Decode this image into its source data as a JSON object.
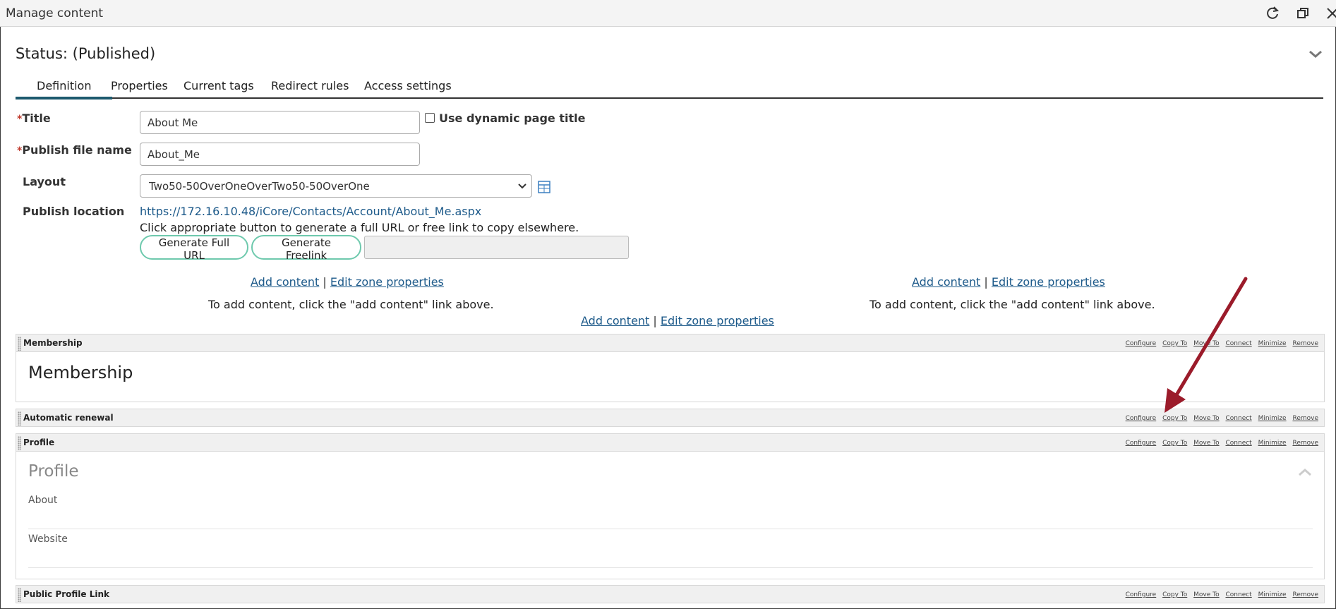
{
  "window": {
    "title": "Manage content",
    "icons": [
      "refresh-icon",
      "restore-icon",
      "close-icon"
    ]
  },
  "status": {
    "text": "Status: (Published)"
  },
  "tabs": [
    {
      "label": "Definition",
      "active": true
    },
    {
      "label": "Properties",
      "active": false
    },
    {
      "label": "Current tags",
      "active": false
    },
    {
      "label": "Redirect rules",
      "active": false
    },
    {
      "label": "Access settings",
      "active": false
    }
  ],
  "form": {
    "required_marker": "*",
    "title_label": "Title",
    "title_value": "About Me",
    "dynamic_title_label": "Use dynamic page title",
    "dynamic_title_checked": false,
    "publish_file_label": "Publish file name",
    "publish_file_value": "About_Me",
    "layout_label": "Layout",
    "layout_value": "Two50-50OverOneOverTwo50-50OverOne",
    "publish_location_label": "Publish location",
    "publish_location_url": "https://172.16.10.48/iCore/Contacts/Account/About_Me.aspx",
    "publish_hint": "Click appropriate button to generate a full URL or free link to copy elsewhere.",
    "generate_full_url": "Generate Full URL",
    "generate_freelink": "Generate Freelink",
    "generated_value": ""
  },
  "zones": {
    "add_content": "Add content",
    "separator": "|",
    "edit_zone": "Edit zone properties",
    "hint": "To add content, click the \"add content\" link above."
  },
  "part_actions": [
    "Configure",
    "Copy To",
    "Move To",
    "Connect",
    "Minimize",
    "Remove"
  ],
  "parts": [
    {
      "title": "Membership",
      "heading": "Membership"
    },
    {
      "title": "Automatic renewal"
    },
    {
      "title": "Profile",
      "heading": "Profile",
      "fields": [
        "About",
        "Website"
      ]
    },
    {
      "title": "Public Profile Link"
    }
  ],
  "colors": {
    "accent": "#1d5a6e",
    "link": "#1d5a8a",
    "button_border": "#6ec9ad",
    "annotation_arrow": "#9b1b2a"
  }
}
